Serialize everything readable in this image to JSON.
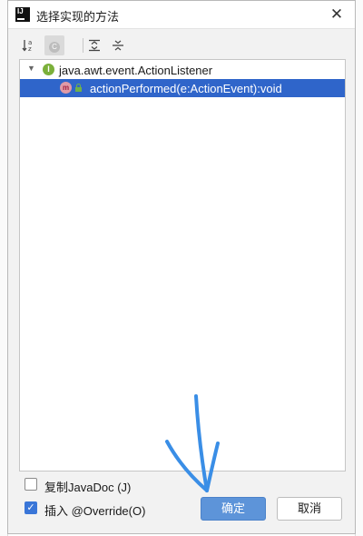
{
  "dialog": {
    "title": "选择实现的方法",
    "app_icon_text": "IJ",
    "close_glyph": "✕"
  },
  "toolbar": {
    "sort_alpha_icon": "↓a z",
    "show_classes_label": "C",
    "expand_all_icon": "⇞",
    "collapse_all_icon": "⇟"
  },
  "tree": {
    "interface": {
      "badge": "I",
      "label": "java.awt.event.ActionListener"
    },
    "method": {
      "badge": "m",
      "label": "actionPerformed(e:ActionEvent):void",
      "selected": true
    }
  },
  "options": {
    "copy_javadoc": {
      "label": "复制JavaDoc (J)",
      "checked": false
    },
    "insert_override": {
      "label": "插入 @Override(O)",
      "checked": true
    }
  },
  "buttons": {
    "ok_label": "确定",
    "cancel_label": "取消"
  },
  "colors": {
    "selection": "#2f65ca",
    "ok_button": "#5d94d9",
    "annotation_stroke": "#3a8ee6"
  }
}
